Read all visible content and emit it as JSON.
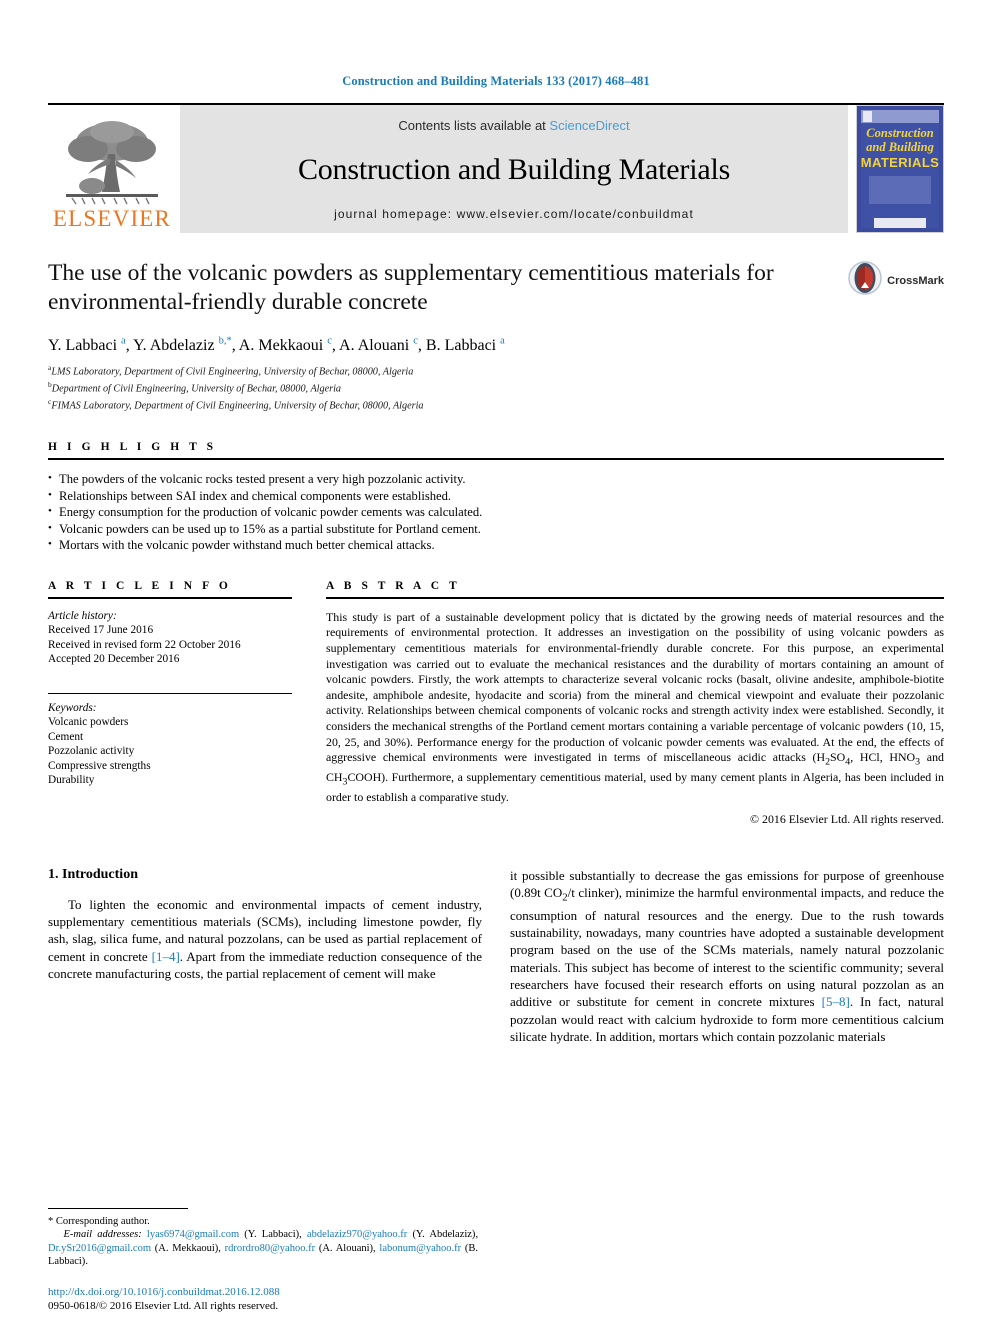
{
  "running_head": "Construction and Building Materials 133 (2017) 468–481",
  "masthead": {
    "publisher_logo_label": "ELSEVIER",
    "contents_prefix": "Contents lists available at ",
    "contents_link": "ScienceDirect",
    "journal_name": "Construction and Building Materials",
    "homepage": "journal homepage: www.elsevier.com/locate/conbuildmat",
    "cover": {
      "line1": "Construction",
      "line2": "and Building",
      "line3": "MATERIALS"
    }
  },
  "article": {
    "title": "The use of the volcanic powders as supplementary cementitious materials for environmental-friendly durable concrete",
    "crossmark_label": "CrossMark",
    "authors_html": "Y. Labbaci <sup>a</sup>, Y. Abdelaziz <sup>b,*</sup>, A. Mekkaoui <sup>c</sup>, A. Alouani <sup>c</sup>, B. Labbaci <sup>a</sup>",
    "affiliations": [
      {
        "marker": "a",
        "text": "LMS Laboratory, Department of Civil Engineering, University of Bechar, 08000, Algeria"
      },
      {
        "marker": "b",
        "text": "Department of Civil Engineering, University of Bechar, 08000, Algeria"
      },
      {
        "marker": "c",
        "text": "FIMAS Laboratory, Department of Civil Engineering, University of Bechar, 08000, Algeria"
      }
    ]
  },
  "highlights": {
    "heading": "H I G H L I G H T S",
    "items": [
      "The powders of the volcanic rocks tested present a very high pozzolanic activity.",
      "Relationships between SAI index and chemical components were established.",
      "Energy consumption for the production of volcanic powder cements was calculated.",
      "Volcanic powders can be used up to 15% as a partial substitute for Portland cement.",
      "Mortars with the volcanic powder withstand much better chemical attacks."
    ]
  },
  "article_info": {
    "heading": "A R T I C L E   I N F O",
    "history_label": "Article history:",
    "history": [
      "Received 17 June 2016",
      "Received in revised form 22 October 2016",
      "Accepted 20 December 2016"
    ],
    "keywords_label": "Keywords:",
    "keywords": [
      "Volcanic powders",
      "Cement",
      "Pozzolanic activity",
      "Compressive strengths",
      "Durability"
    ]
  },
  "abstract": {
    "heading": "A B S T R A C T",
    "text": "This study is part of a sustainable development policy that is dictated by the growing needs of material resources and the requirements of environmental protection. It addresses an investigation on the possibility of using volcanic powders as supplementary cementitious materials for environmental-friendly durable concrete. For this purpose, an experimental investigation was carried out to evaluate the mechanical resistances and the durability of mortars containing an amount of volcanic powders. Firstly, the work attempts to characterize several volcanic rocks (basalt, olivine andesite, amphibole-biotite andesite, amphibole andesite, hyodacite and scoria) from the mineral and chemical viewpoint and evaluate their pozzolanic activity. Relationships between chemical components of volcanic rocks and strength activity index were established. Secondly, it considers the mechanical strengths of the Portland cement mortars containing a variable percentage of volcanic powders (10, 15, 20, 25, and 30%). Performance energy for the production of volcanic powder cements was evaluated. At the end, the effects of aggressive chemical environments were investigated in terms of miscellaneous acidic attacks (H2SO4, HCl, HNO3 and CH3COOH). Furthermore, a supplementary cementitious material, used by many cement plants in Algeria, has been included in order to establish a comparative study.",
    "copyright": "© 2016 Elsevier Ltd. All rights reserved."
  },
  "introduction": {
    "section_number_title": "1. Introduction",
    "left_paragraph_pre": "To lighten the economic and environmental impacts of cement industry, supplementary cementitious materials (SCMs), including limestone powder, fly ash, slag, silica fume, and natural pozzolans, can be used as partial replacement of cement in concrete ",
    "left_ref_1": "[1–4]",
    "left_paragraph_post": ". Apart from the immediate reduction consequence of the concrete manufacturing costs, the partial replacement of cement will make",
    "right_paragraph_pre": "it possible substantially to decrease the gas emissions for purpose of greenhouse (0.89t CO2/t clinker), minimize the harmful environmental impacts, and reduce the consumption of natural resources and the energy. Due to the rush towards sustainability, nowadays, many countries have adopted a sustainable development program based on the use of the SCMs materials, namely natural pozzolanic materials. This subject has become of interest to the scientific community; several researchers have focused their research efforts on using natural pozzolan as an additive or substitute for cement in concrete mixtures ",
    "right_ref_1": "[5–8]",
    "right_paragraph_post": ". In fact, natural pozzolan would react with calcium hydroxide to form more cementitious calcium silicate hydrate. In addition, mortars which contain pozzolanic materials"
  },
  "footnote": {
    "corresponding": "* Corresponding author.",
    "emails_label": "E-mail addresses:",
    "emails": [
      {
        "address": "lyas6974@gmail.com",
        "person": "(Y. Labbaci)"
      },
      {
        "address": "abdelaziz970@yahoo.fr",
        "person": "(Y. Abdelaziz)"
      },
      {
        "address": "Dr.ySr2016@gmail.com",
        "person": "(A. Mekkaoui)"
      },
      {
        "address": "rdrordro80@yahoo.fr",
        "person": "(A. Alouani)"
      },
      {
        "address": "labonum@yahoo.fr",
        "person": "(B. Labbaci)"
      }
    ],
    "doi": "http://dx.doi.org/10.1016/j.conbuildmat.2016.12.088",
    "issn_line": "0950-0618/© 2016 Elsevier Ltd. All rights reserved."
  },
  "colors": {
    "link_blue": "#1a7bb9",
    "sciencedirect_blue": "#4a9cd6",
    "elsevier_orange": "#e87722",
    "cover_blue": "#3f51a5",
    "cover_yellow": "#f3d33b"
  }
}
